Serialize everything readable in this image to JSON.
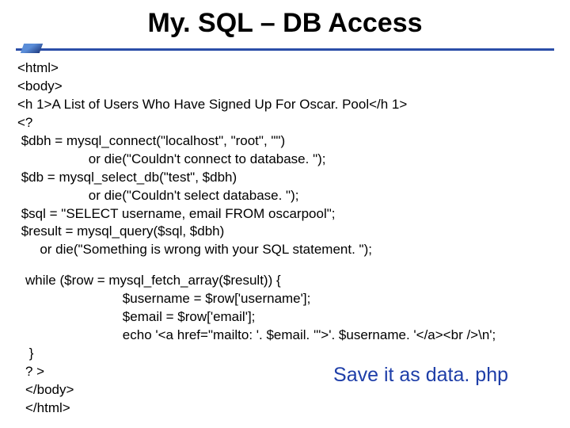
{
  "title": "My. SQL – DB Access",
  "code_block1": "<html>\n<body>\n<h 1>A List of Users Who Have Signed Up For Oscar. Pool</h 1>\n<?\n $dbh = mysql_connect(\"localhost\", \"root\", \"\")\n                   or die(\"Couldn't connect to database. \");\n $db = mysql_select_db(\"test\", $dbh)\n                   or die(\"Couldn't select database. \");\n $sql = \"SELECT username, email FROM oscarpool\";\n $result = mysql_query($sql, $dbh)\n      or die(\"Something is wrong with your SQL statement. \");",
  "code_block2": "while ($row = mysql_fetch_array($result)) {\n                          $username = $row['username'];\n                          $email = $row['email'];\n                          echo '<a href=\"mailto: '. $email. '\">'. $username. '</a><br />\\n';\n }\n? >\n</body>\n</html>",
  "save_note": "Save it as data. php"
}
